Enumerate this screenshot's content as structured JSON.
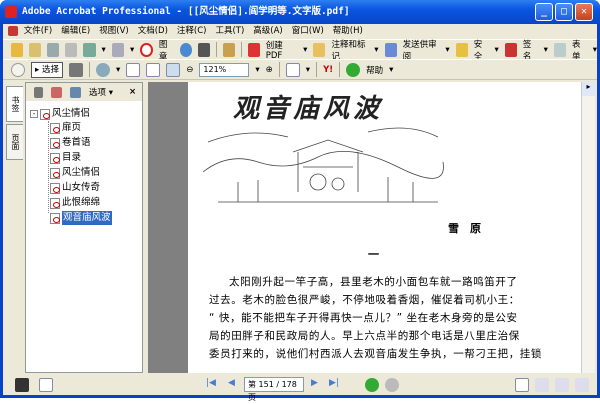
{
  "window": {
    "title": "Adobe Acrobat Professional - [[风尘情侣].阎学明等.文字版.pdf]",
    "min": "_",
    "max": "□",
    "close": "✕"
  },
  "menu": [
    "文件(F)",
    "编辑(E)",
    "视图(V)",
    "文档(D)",
    "注释(C)",
    "工具(T)",
    "高级(A)",
    "窗口(W)",
    "帮助(H)"
  ],
  "toolbar1": {
    "stamp": "图章",
    "create_pdf": "创建 PDF",
    "comment": "注释和标记",
    "review": "发送供审阅",
    "security": "安全",
    "sign": "签名",
    "forms": "表单"
  },
  "toolbar2": {
    "select": "选择",
    "zoom": "121%",
    "help": "帮助"
  },
  "nav_tabs": [
    "书签",
    "页面"
  ],
  "panel": {
    "options": "选项",
    "close": "×"
  },
  "bookmarks": {
    "root": "风尘情侣",
    "children": [
      "扉页",
      "卷首语",
      "目录",
      "风尘情侣",
      "山女传奇",
      "此恨绵绵",
      "观音庙风波"
    ],
    "selected": "观音庙风波"
  },
  "page": {
    "heading_art": "观音庙风波",
    "author": "雪　原",
    "section": "一",
    "lines": [
      "太阳刚升起一竿子高，县里老木的小面包车就一路鸣笛开了",
      "过去。老木的脸色很严峻，不停地吸着香烟，催促着司机小王：",
      "“ 快，能不能把车子开得再快一点儿？” 坐在老木身旁的是公安",
      "局的田胖子和民政局的人。早上六点半的那个电话是八里庄治保",
      "委员打来的，说他们村西派人去观音庙发生争执，一帮刁王把，挂锁"
    ]
  },
  "status": {
    "page_display": "第 151 / 178 页"
  }
}
